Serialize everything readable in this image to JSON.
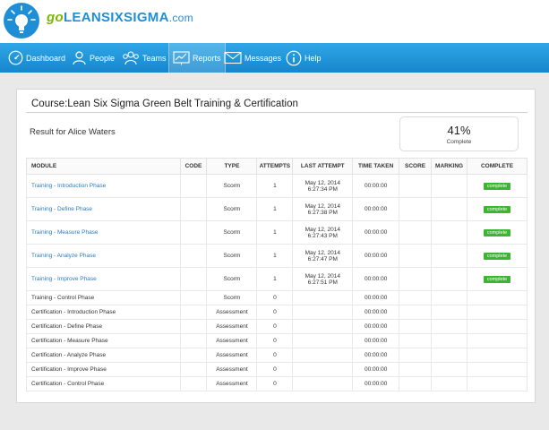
{
  "brand": {
    "go": "go",
    "name": "LEANSIXSIGMA",
    "domain": ".com",
    "color_green": "#7ab800",
    "color_blue": "#1e8fd6"
  },
  "nav": {
    "items": [
      {
        "label": "Dashboard",
        "icon": "dashboard-icon"
      },
      {
        "label": "People",
        "icon": "person-icon"
      },
      {
        "label": "Teams",
        "icon": "team-icon"
      },
      {
        "label": "Reports",
        "icon": "chart-icon"
      },
      {
        "label": "Messages",
        "icon": "envelope-icon"
      },
      {
        "label": "Help",
        "icon": "info-icon"
      }
    ],
    "active": "Reports"
  },
  "course": {
    "title": "Course:Lean Six Sigma Green Belt Training & Certification"
  },
  "result": {
    "label": "Result for Alice Waters",
    "percent": "41%",
    "percent_label": "Complete"
  },
  "table": {
    "headers": [
      "MODULE",
      "CODE",
      "TYPE",
      "ATTEMPTS",
      "LAST ATTEMPT",
      "TIME TAKEN",
      "SCORE",
      "MARKING",
      "COMPLETE"
    ],
    "rows": [
      {
        "module": "Training - Introduction Phase",
        "code": "",
        "type": "Scorm",
        "attempts": "1",
        "date": "May 12, 2014",
        "time": "6:27:34 PM",
        "taken": "00:00:00",
        "score": "",
        "marking": "",
        "complete": "complete"
      },
      {
        "module": "Training - Define Phase",
        "code": "",
        "type": "Scorm",
        "attempts": "1",
        "date": "May 12, 2014",
        "time": "6:27:38 PM",
        "taken": "00:00:00",
        "score": "",
        "marking": "",
        "complete": "complete"
      },
      {
        "module": "Training - Measure Phase",
        "code": "",
        "type": "Scorm",
        "attempts": "1",
        "date": "May 12, 2014",
        "time": "6:27:43 PM",
        "taken": "00:00:00",
        "score": "",
        "marking": "",
        "complete": "complete"
      },
      {
        "module": "Training - Analyze Phase",
        "code": "",
        "type": "Scorm",
        "attempts": "1",
        "date": "May 12, 2014",
        "time": "6:27:47 PM",
        "taken": "00:00:00",
        "score": "",
        "marking": "",
        "complete": "complete"
      },
      {
        "module": "Training - Improve Phase",
        "code": "",
        "type": "Scorm",
        "attempts": "1",
        "date": "May 12, 2014",
        "time": "6:27:51 PM",
        "taken": "00:00:00",
        "score": "",
        "marking": "",
        "complete": "complete"
      },
      {
        "module": "Training - Control Phase",
        "code": "",
        "type": "Scorm",
        "attempts": "0",
        "date": "",
        "time": "",
        "taken": "00:00:00",
        "score": "",
        "marking": "",
        "complete": ""
      },
      {
        "module": "Certification - Introduction Phase",
        "code": "",
        "type": "Assessment",
        "attempts": "0",
        "date": "",
        "time": "",
        "taken": "00:00:00",
        "score": "",
        "marking": "",
        "complete": ""
      },
      {
        "module": "Certification - Define Phase",
        "code": "",
        "type": "Assessment",
        "attempts": "0",
        "date": "",
        "time": "",
        "taken": "00:00:00",
        "score": "",
        "marking": "",
        "complete": ""
      },
      {
        "module": "Certification - Measure Phase",
        "code": "",
        "type": "Assessment",
        "attempts": "0",
        "date": "",
        "time": "",
        "taken": "00:00:00",
        "score": "",
        "marking": "",
        "complete": ""
      },
      {
        "module": "Certification - Analyze Phase",
        "code": "",
        "type": "Assessment",
        "attempts": "0",
        "date": "",
        "time": "",
        "taken": "00:00:00",
        "score": "",
        "marking": "",
        "complete": ""
      },
      {
        "module": "Certification - Improve Phase",
        "code": "",
        "type": "Assessment",
        "attempts": "0",
        "date": "",
        "time": "",
        "taken": "00:00:00",
        "score": "",
        "marking": "",
        "complete": ""
      },
      {
        "module": "Certification - Control Phase",
        "code": "",
        "type": "Assessment",
        "attempts": "0",
        "date": "",
        "time": "",
        "taken": "00:00:00",
        "score": "",
        "marking": "",
        "complete": ""
      }
    ]
  },
  "colors": {
    "nav_bar": "#1e96dc",
    "link": "#2b7bbf",
    "complete_badge": "#3cb533"
  }
}
